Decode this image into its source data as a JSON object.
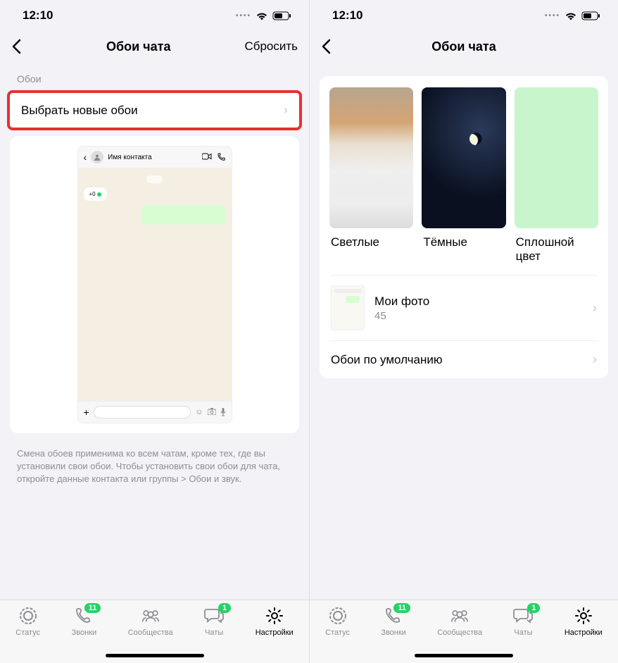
{
  "status": {
    "time": "12:10"
  },
  "left": {
    "nav": {
      "title": "Обои чата",
      "action": "Сбросить"
    },
    "section_header": "Обои",
    "choose_label": "Выбрать новые обои",
    "preview": {
      "contact_name": "Имя контакта",
      "in_text": "+0"
    },
    "footer": "Смена обоев применима ко всем чатам, кроме тех, где вы установили свои обои. Чтобы установить свои обои для чата, откройте данные контакта или группы > Обои и звук."
  },
  "right": {
    "nav": {
      "title": "Обои чата"
    },
    "categories": {
      "light": "Светлые",
      "dark": "Тёмные",
      "solid": "Сплошной цвет"
    },
    "my_photos": {
      "title": "Мои фото",
      "count": "45"
    },
    "default_label": "Обои по умолчанию"
  },
  "tabs": {
    "status": "Статус",
    "calls": "Звонки",
    "calls_badge": "11",
    "communities": "Сообщества",
    "chats": "Чаты",
    "chats_badge": "1",
    "settings": "Настройки"
  }
}
